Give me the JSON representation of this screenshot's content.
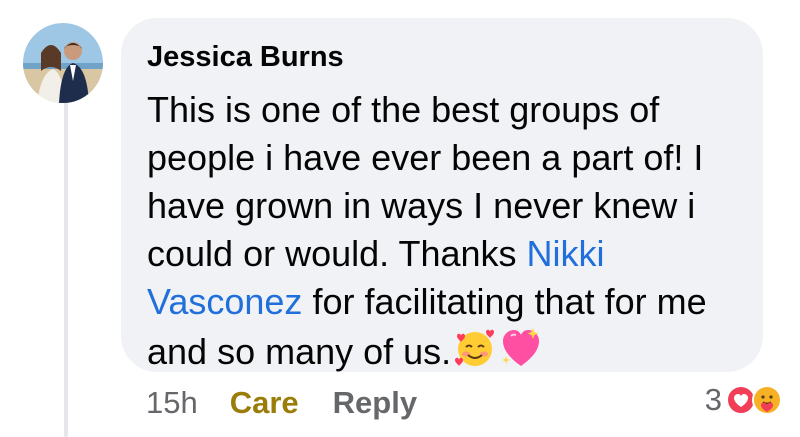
{
  "comment": {
    "author": "Jessica Burns",
    "text_before_mention": "This is one of the best groups of people i have ever been a part of! I have grown in ways I never knew i could or would. Thanks ",
    "mention": "Nikki Vasconez",
    "text_after_mention": " for facilitating that for me and so many of us.",
    "emojis": [
      "smiling-face-with-hearts-icon",
      "sparkling-heart-icon"
    ]
  },
  "actions": {
    "timestamp": "15h",
    "reaction_label": "Care",
    "reply_label": "Reply"
  },
  "reactions": {
    "count": "3",
    "icons": [
      "love-icon",
      "care-icon"
    ]
  },
  "colors": {
    "bubble": "#f0f2f5",
    "mention": "#216fdb",
    "care": "#9a7c08",
    "muted": "#65676b"
  }
}
